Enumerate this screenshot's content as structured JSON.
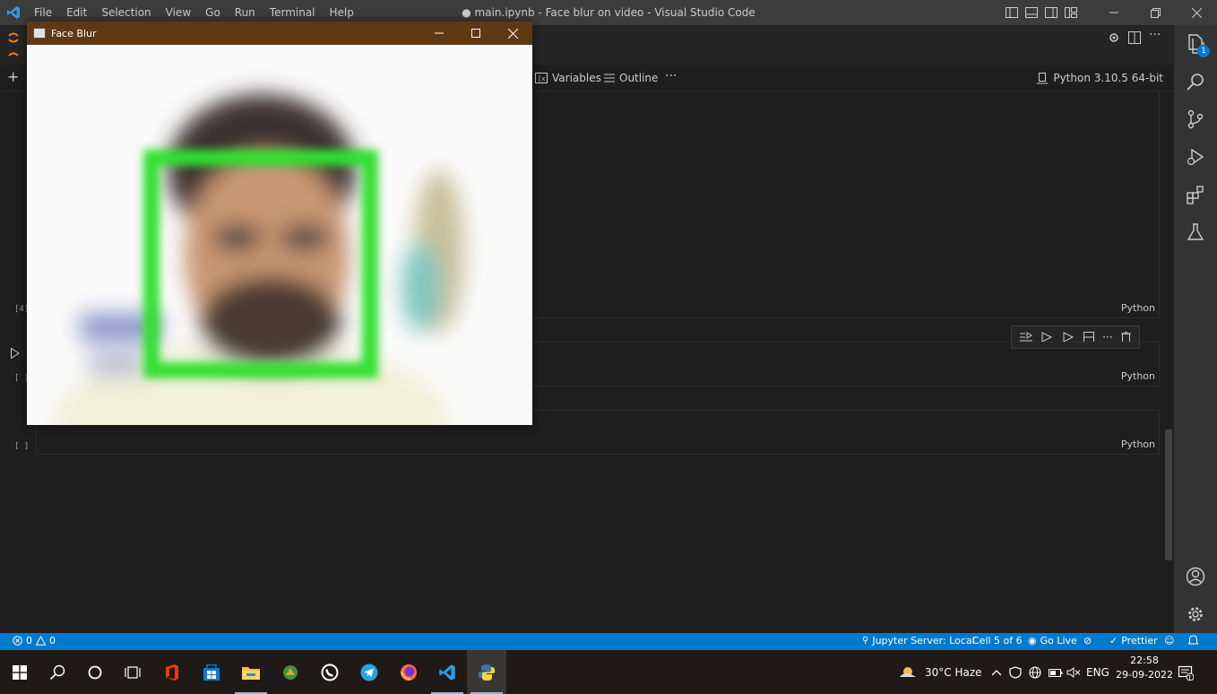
{
  "window_title": "● main.ipynb - Face blur on video - Visual Studio Code",
  "menu": [
    "File",
    "Edit",
    "Selection",
    "View",
    "Go",
    "Run",
    "Terminal",
    "Help"
  ],
  "notebook_toolbar": {
    "variables": "Variables",
    "outline": "Outline",
    "more": "···",
    "add": "+"
  },
  "kernel": "Python 3.10.5 64-bit",
  "cells": [
    {
      "exec": "[4]",
      "lang": "Python"
    },
    {
      "exec": "[ ]",
      "lang": "Python"
    },
    {
      "exec": "[ ]",
      "lang": "Python"
    }
  ],
  "activity_badge": "1",
  "status": {
    "errors": "0",
    "warnings": "0",
    "jupyter": "Jupyter Server: Local",
    "cell": "Cell 5 of 6",
    "golive": "Go Live",
    "prettier": "Prettier"
  },
  "face_window": {
    "title": "Face Blur"
  },
  "taskbar": {
    "weather": "30°C Haze",
    "lang": "ENG",
    "time": "22:58",
    "date": "29-09-2022",
    "notif_count": "1"
  },
  "colors": {
    "statusbar": "#007acc",
    "accent": "#0078d4",
    "face_title": "#603813",
    "face_box": "#33e033"
  }
}
